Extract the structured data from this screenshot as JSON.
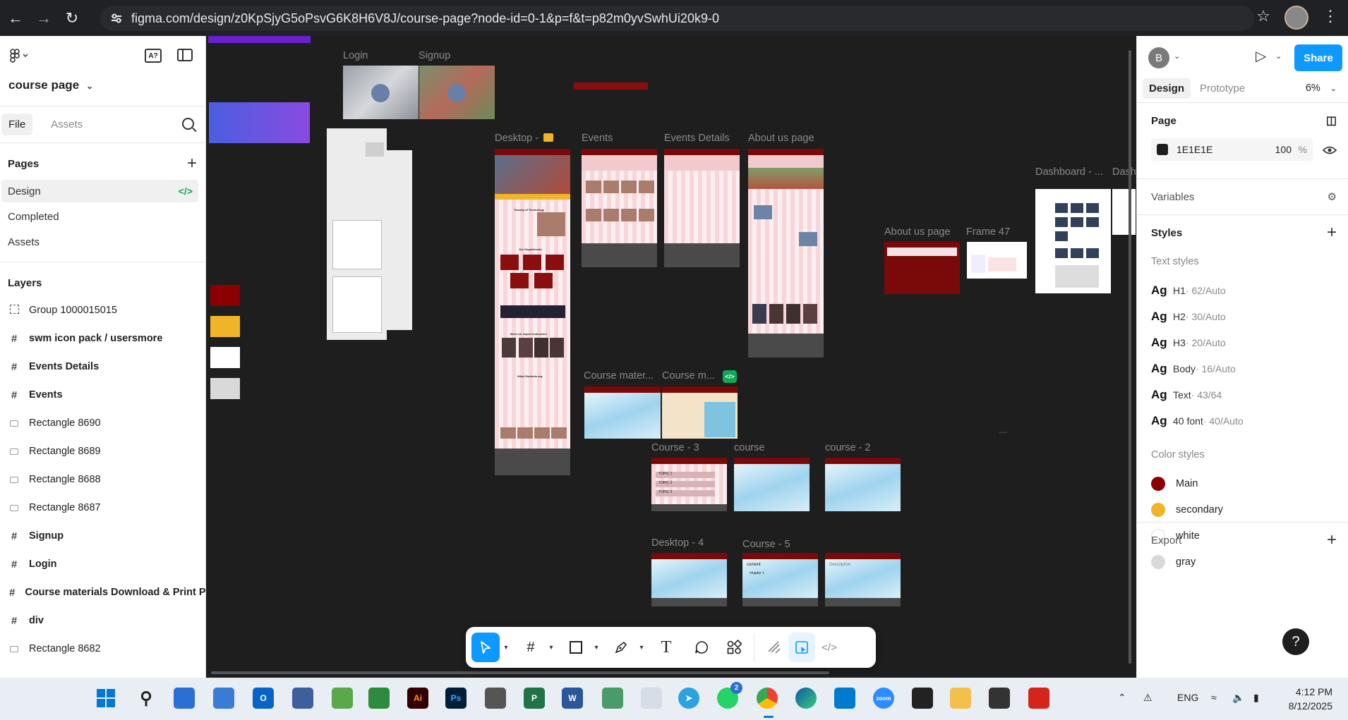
{
  "browser": {
    "url": "figma.com/design/z0KpSjyG5oPsvG6K8H6V8J/course-page?node-id=0-1&p=f&t=p82m0yvSwhUi20k9-0"
  },
  "left_panel": {
    "file_name": "course page",
    "tabs": [
      "File",
      "Assets"
    ],
    "pages_heading": "Pages",
    "pages": [
      {
        "label": "Design",
        "active": true
      },
      {
        "label": "Completed",
        "active": false
      },
      {
        "label": "Assets",
        "active": false
      }
    ],
    "layers_heading": "Layers",
    "layers": [
      {
        "label": "Group 1000015015",
        "icon": "group-icon",
        "bold": false
      },
      {
        "label": "swm icon pack / usersmore",
        "icon": "frame-icon",
        "bold": true
      },
      {
        "label": "Events Details",
        "icon": "frame-icon",
        "bold": true
      },
      {
        "label": "Events",
        "icon": "frame-icon",
        "bold": true
      },
      {
        "label": "Rectangle 8690",
        "icon": "rectangle-icon",
        "bold": false
      },
      {
        "label": "Rectangle 8689",
        "icon": "rectangle-icon",
        "bold": false
      },
      {
        "label": "Rectangle 8688",
        "icon": "rectangle-icon",
        "bold": false
      },
      {
        "label": "Rectangle 8687",
        "icon": "rectangle-icon",
        "bold": false
      },
      {
        "label": "Signup",
        "icon": "frame-icon",
        "bold": true
      },
      {
        "label": "Login",
        "icon": "frame-icon",
        "bold": true
      },
      {
        "label": "Course materials Download & Print Pa",
        "icon": "frame-icon",
        "bold": true
      },
      {
        "label": "div",
        "icon": "frame-icon",
        "bold": true
      },
      {
        "label": "Rectangle 8682",
        "icon": "rectangle-icon",
        "bold": false
      }
    ]
  },
  "right_panel": {
    "avatar_initial": "B",
    "share_label": "Share",
    "tabs": [
      "Design",
      "Prototype"
    ],
    "zoom": "6%",
    "page_heading": "Page",
    "page_fill": {
      "hex": "1E1E1E",
      "opacity": "100",
      "unit": "%"
    },
    "variables_heading": "Variables",
    "styles_heading": "Styles",
    "text_styles_heading": "Text styles",
    "text_styles": [
      {
        "name": "H1",
        "meta": " · 62/Auto"
      },
      {
        "name": "H2",
        "meta": " · 30/Auto"
      },
      {
        "name": "H3",
        "meta": " · 20/Auto"
      },
      {
        "name": "Body",
        "meta": " · 16/Auto"
      },
      {
        "name": "Text",
        "meta": " · 43/64"
      },
      {
        "name": "40 font",
        "meta": " · 40/Auto"
      }
    ],
    "ag_glyph": "Ag",
    "color_styles_heading": "Color styles",
    "color_styles": [
      {
        "name": "Main",
        "color": "#8b0000"
      },
      {
        "name": "secondary",
        "color": "#f0b429"
      },
      {
        "name": "white",
        "color": "#ffffff"
      },
      {
        "name": "gray",
        "color": "#d9d9d9"
      }
    ],
    "export_heading": "Export",
    "help_label": "?"
  },
  "canvas": {
    "frame_labels": {
      "login": "Login",
      "signup": "Signup",
      "desktop": "Desktop -",
      "events": "Events",
      "events_details": "Events Details",
      "about_us": "About us page",
      "about_us_2": "About us page",
      "frame47": "Frame 47",
      "dashboard": "Dashboard - ...",
      "dash2": "Dash",
      "course_mater": "Course mater...",
      "course_m": "Course m...",
      "course3": "Course - 3",
      "course": "course",
      "course2": "course - 2",
      "desktop4": "Desktop - 4",
      "course5": "Course - 5"
    },
    "swatches": [
      "#8b0000",
      "#f0b429",
      "#ffffff",
      "#d9d9d9"
    ],
    "tiny_text": {
      "departments": "Our Departments",
      "faculty": "Faculty of Technology",
      "instructors": "Meet our expert instructors",
      "students": "What Students say",
      "topic1": "TOPIC 1",
      "topic2": "TOPIC 2",
      "topic3": "TOPIC 3",
      "content": "content",
      "chapter1": "chapter 1",
      "description": "Description"
    }
  },
  "toolbar": {
    "tools": [
      "move",
      "frame",
      "shape",
      "pen",
      "text",
      "comment",
      "actions",
      "draw",
      "design",
      "dev"
    ]
  },
  "taskbar": {
    "language": "ENG",
    "time": "4:12 PM",
    "date": "8/12/2025",
    "badge_count": "2"
  },
  "colors": {
    "accent": "#0d99ff",
    "canvas_bg": "#1e1e1e",
    "brand_red": "#8b0000",
    "dev_green": "#0fa958"
  }
}
